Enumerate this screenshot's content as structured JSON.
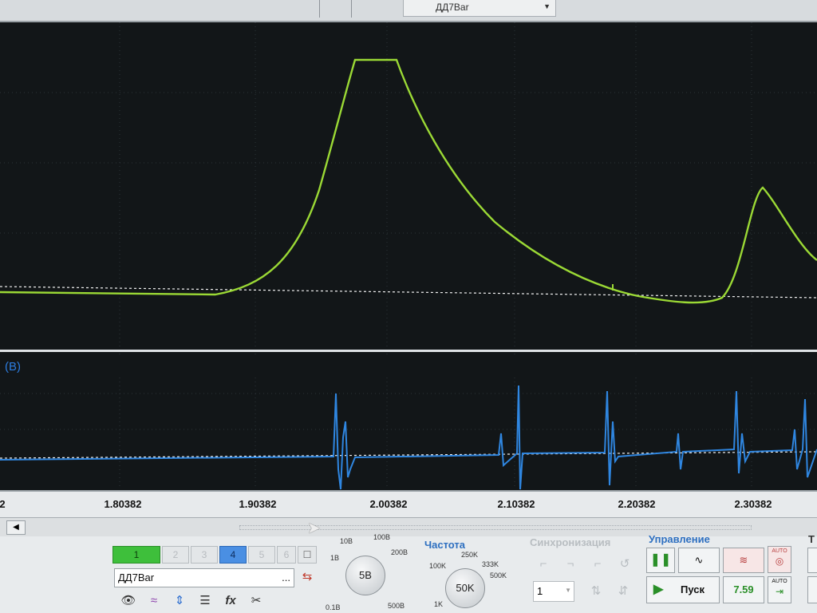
{
  "toolbar": {
    "channel_select_value": "ДД7Bar"
  },
  "channels": [
    {
      "name": "green-trace",
      "color": "#9bd935"
    },
    {
      "name": "blue-trace",
      "color": "#2f86e0",
      "label": "(B)"
    }
  ],
  "time_axis": {
    "labels": [
      "2",
      "1.80382",
      "1.90382",
      "2.00382",
      "2.10382",
      "2.20382",
      "2.30382"
    ]
  },
  "channel_tabs": [
    {
      "label": "1",
      "state": "active-green"
    },
    {
      "label": "2",
      "state": "disabled"
    },
    {
      "label": "3",
      "state": "disabled"
    },
    {
      "label": "4",
      "state": "active-blue"
    },
    {
      "label": "5",
      "state": "disabled"
    },
    {
      "label": "6",
      "state": "disabled"
    }
  ],
  "channel_name": {
    "value": "ДД7Bar",
    "dots": "..."
  },
  "voltage_dial": {
    "value": "5В",
    "scale": [
      "10В",
      "100В",
      "1В",
      "200В",
      "0.1В",
      "500В"
    ]
  },
  "frequency": {
    "title": "Частота",
    "value": "50K",
    "scale": [
      "250K",
      "100K",
      "333K",
      "500K",
      "1K"
    ]
  },
  "sync": {
    "title": "Синхронизация",
    "value": "1"
  },
  "control": {
    "title": "Управление",
    "run_label": "Пуск",
    "counter": "7.59",
    "auto_label": "AUTO"
  },
  "cut_group_title": "Т"
}
